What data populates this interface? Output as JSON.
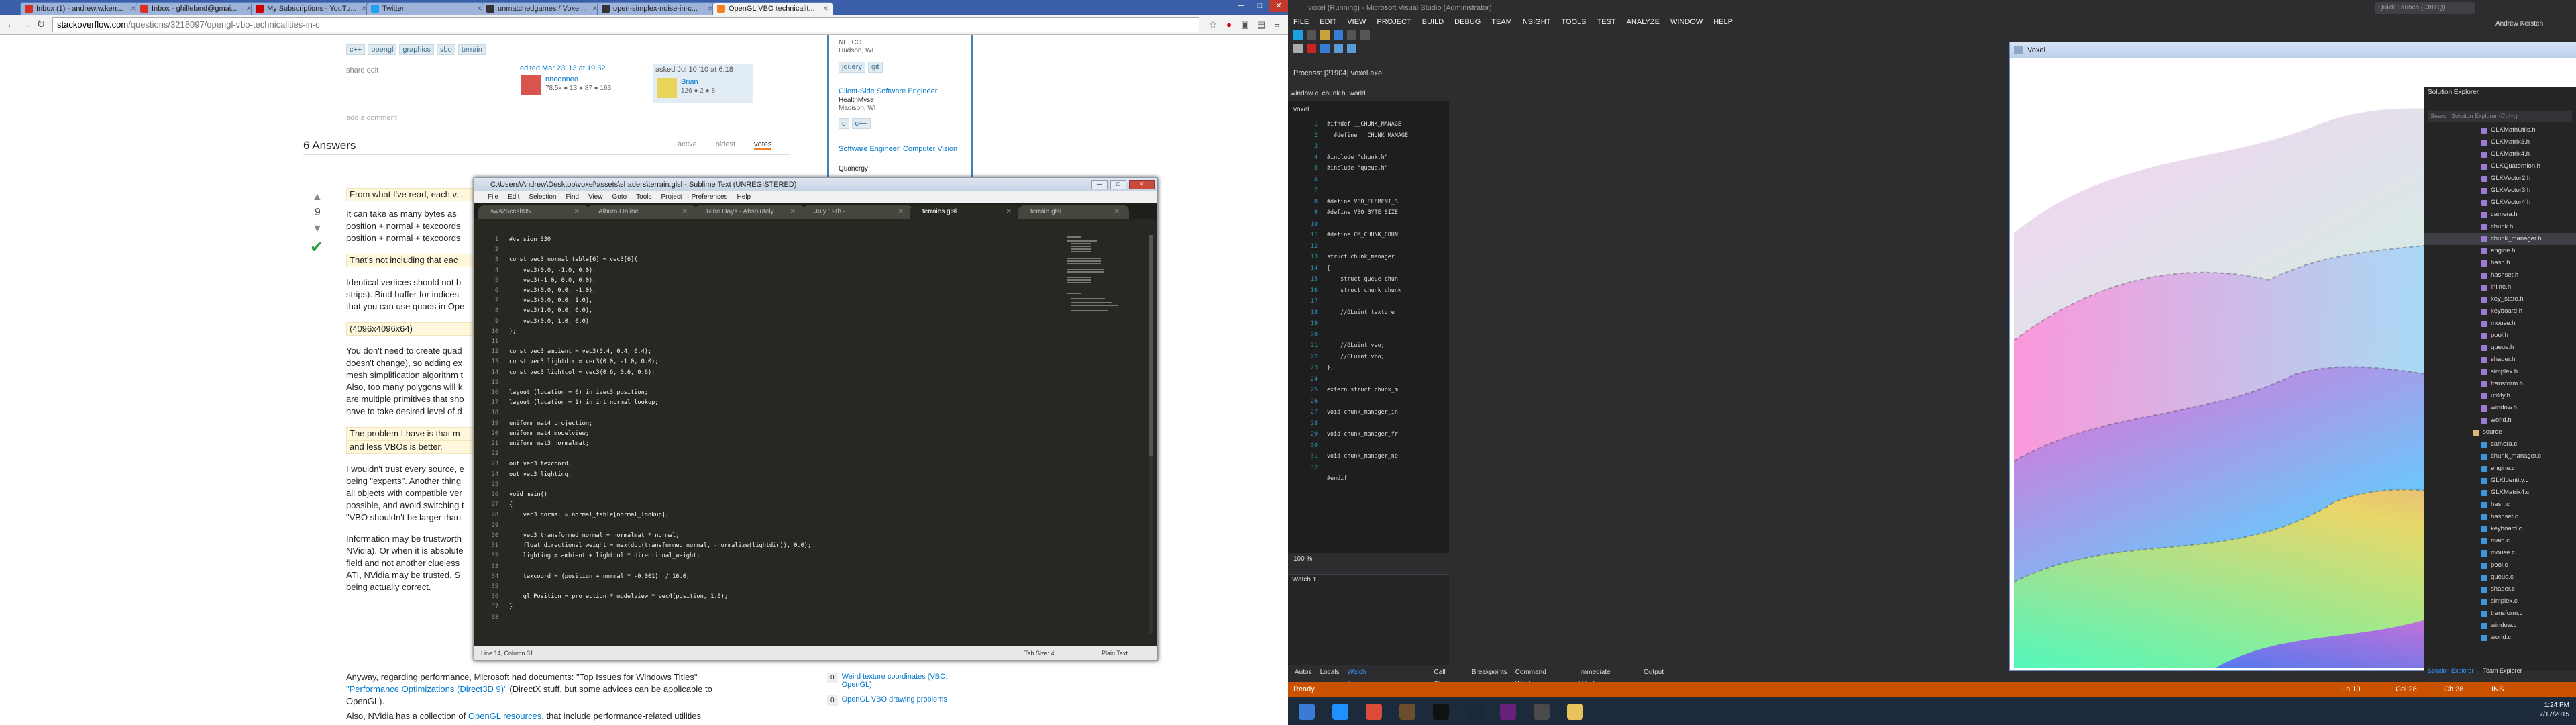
{
  "chrome": {
    "tabs": [
      {
        "label": "Inbox (1) - andrew.w.kerr...",
        "color": "#d93025"
      },
      {
        "label": "Inbox - ghilleland@gmai...",
        "color": "#d93025"
      },
      {
        "label": "My Subscriptions - YouTu...",
        "color": "#cc0000"
      },
      {
        "label": "Twitter",
        "color": "#1da1f2"
      },
      {
        "label": "unmatchedgames / Voxe...",
        "color": "#333333"
      },
      {
        "label": "open-simplex-noise-in-c...",
        "color": "#333333"
      },
      {
        "label": "OpenGL VBO technicalit...",
        "color": "#f48024"
      }
    ],
    "url_domain": "stackoverflow.com",
    "url_path": "/questions/3218097/opengl-vbo-technicalities-in-c"
  },
  "so": {
    "tags_top": [
      "c++",
      "opengl",
      "graphics",
      "vbo",
      "terrain"
    ],
    "share_edit": "share  edit",
    "edited": "edited Mar 23 '13 at 19:32",
    "editor": "nneonneo",
    "editor_rep": "78.5k  ● 13  ● 87  ● 163",
    "asked": "asked Jul 10 '10 at 6:18",
    "asker": "Brian",
    "asker_rep": "126  ● 2  ● 8",
    "add_comment": "add a comment",
    "answers_count": "6 Answers",
    "sort_tabs": [
      "active",
      "oldest",
      "votes"
    ],
    "vote_count": "9",
    "answer_lines": [
      "From what I've read, each v...",
      "It can take as many bytes as",
      "position + normal + texcoords",
      "position + normal + texcoords",
      "That's not including that eac",
      "Identical vertices should not b",
      "strips). Bind buffer for indices",
      "that you can use quads in Ope",
      "(4096x4096x64)",
      "You don't need to create quad",
      "doesn't change), so adding ex",
      "mesh simplification algorithm t",
      "Also, too many polygons will k",
      "are multiple primitives that sho",
      "have to take desired level of d",
      "The problem I have is that m",
      "and less VBOs is better.",
      "I wouldn't trust every source, e",
      "being \"experts\". Another thing",
      "all objects with compatible ver",
      "possible, and avoid switching t",
      "\"VBO shouldn't be larger than",
      "Information may be trustworth",
      "NVidia). Or when it is absolute",
      "field and not another clueless",
      "ATI, NVidia may be trusted. S",
      "being actually correct."
    ],
    "anyway_text": "Anyway, regarding performance, Microsoft had documents: \"Top Issues for Windows Titles\"",
    "perf_link": "\"Performance Optimizations (Direct3D 9)\"",
    "perf_rest": " (DirectX stuff, but some advices can be applicable to",
    "perf_end": "OpenGL).",
    "nvidia_text": "Also, NVidia has a collection of ",
    "nvidia_link": "OpenGL resources",
    "nvidia_rest": ", that include performance-related utilities",
    "side_jobs": [
      {
        "loc": "NE, CO",
        "title": "",
        "company": ""
      },
      {
        "loc": "Hudson, WI",
        "title": "",
        "company": ""
      },
      {
        "loc": "Madison, WI",
        "title": "Client-Side Software Engineer",
        "company": "HealthMyse"
      },
      {
        "loc": "",
        "title": "Software Engineer, Computer Vision",
        "company": "Quanergy"
      }
    ],
    "side_tags1": [
      "jquery",
      "git"
    ],
    "side_tags2": [
      "c",
      "c++"
    ],
    "related": [
      {
        "count": "0",
        "title": "Weird texture coordinates (VBO, OpenGL)"
      },
      {
        "count": "0",
        "title": "OpenGL VBO drawing problems"
      }
    ]
  },
  "sublime": {
    "title": "C:\\Users\\Andrew\\Desktop\\voxel\\assets\\shaders\\terrain.glsl - Sublime Text (UNREGISTERED)",
    "menu": [
      "File",
      "Edit",
      "Selection",
      "Find",
      "View",
      "Goto",
      "Tools",
      "Project",
      "Preferences",
      "Help"
    ],
    "tabs": [
      "sws26ccsb05",
      "Album Online",
      "Nine Days - Absolutely",
      "July 19th -",
      "terrains.glsl",
      "terrain.glsl"
    ],
    "line_numbers": "1\n2\n3\n4\n5\n6\n7\n8\n9\n10\n11\n12\n13\n14\n15\n16\n17\n18\n19\n20\n21\n22\n23\n24\n25\n26\n27\n28\n29\n30\n31\n32\n33\n34\n35\n36\n37\n38",
    "code": "#version 330\n\nconst vec3 normal_table[6] = vec3[6](\n    vec3(0.0, -1.0, 0.0),\n    vec3(-1.0, 0.0, 0.0),\n    vec3(0.0, 0.0, -1.0),\n    vec3(0.0, 0.0, 1.0),\n    vec3(1.0, 0.0, 0.0),\n    vec3(0.0, 1.0, 0.0)\n);\n\nconst vec3 ambient = vec3(0.4, 0.4, 0.4);\nconst vec3 lightdir = vec3(0.0, -1.0, 0.0);\nconst vec3 lightcol = vec3(0.6, 0.6, 0.6);\n\nlayout (location = 0) in ivec3 position;\nlayout (location = 1) in int normal_lookup;\n\nuniform mat4 projection;\nuniform mat4 modelview;\nuniform mat3 normalmat;\n\nout vec3 texcoord;\nout vec3 lighting;\n\nvoid main()\n{\n    vec3 normal = normal_table[normal_lookup];\n\n    vec3 transformed_normal = normalmat * normal;\n    float directional_weight = max(dot(transformed_normal, -normalize(lightdir)), 0.0);\n    lighting = ambient + lightcol * directional_weight;\n\n    texcoord = (position + normal * -0.001)  / 16.0;\n\n    gl_Position = projection * modelview * vec4(position, 1.0);\n}\n",
    "status_left": "Line 14, Column 31",
    "status_tab": "Tab Size: 4",
    "status_syntax": "Plain Text"
  },
  "vs": {
    "title": "voxel (Running) - Microsoft Visual Studio (Administrator)",
    "menu": [
      "FILE",
      "EDIT",
      "VIEW",
      "PROJECT",
      "BUILD",
      "DEBUG",
      "TEAM",
      "NSIGHT",
      "TOOLS",
      "TEST",
      "ANALYZE",
      "WINDOW",
      "HELP"
    ],
    "quick_launch": "Quick Launch (Ctrl+Q)",
    "user": "Andrew Kersten",
    "process": "Process:  [21904] voxel.exe",
    "doc_tabs": [
      "window.c",
      "chunk.h",
      "world."
    ],
    "scope": "voxel",
    "code_lines": "#ifndef __CHUNK_MANAGE\n  #define __CHUNK_MANAGE\n\n#include \"chunk.h\"\n#include \"queue.h\"\n\n\n#define VBO_ELEMENT_S\n#define VBO_BYTE_SIZE\n\n#define CM_CHUNK_COUN\n\nstruct chunk_manager\n{\n    struct queue chun\n    struct chunk chunk\n\n    //GLuint texture\n\n\n    //GLuint vao;\n    //GLuint vbo;\n};\n\nextern struct chunk_m\n\nvoid chunk_manager_in\n\nvoid chunk_manager_fr\n\nvoid chunk_manager_ne\n\n#endif\n",
    "line_nums": "1\n2\n3\n4\n5\n6\n7\n8\n9\n10\n11\n12\n13\n14\n15\n16\n17\n18\n19\n20\n21\n22\n23\n24\n25\n26\n27\n28\n29\n30\n31\n32",
    "zoom": "100 %",
    "watch_title": "Watch 1",
    "bottom_tabs_left": [
      "Autos",
      "Locals",
      "Watch 1"
    ],
    "bottom_tabs_right": [
      "Call Stack",
      "Breakpoints",
      "Command Window",
      "Immediate Window",
      "Output"
    ],
    "status": "Ready",
    "status_ln": "Ln 10",
    "status_col": "Col 28",
    "status_ch": "Ch 28",
    "status_ins": "INS",
    "solution_explorer": "Solution Explorer",
    "se_search": "Search Solution Explorer (Ctrl+;)",
    "se_files": [
      "GLKMathUtils.h",
      "GLKMatrix3.h",
      "GLKMatrix4.h",
      "GLKQuaternion.h",
      "GLKVector2.h",
      "GLKVector3.h",
      "GLKVector4.h",
      "camera.h",
      "chunk.h",
      "chunk_manager.h",
      "engine.h",
      "hash.h",
      "hashset.h",
      "inline.h",
      "key_state.h",
      "keyboard.h",
      "mouse.h",
      "pool.h",
      "queue.h",
      "shader.h",
      "simplex.h",
      "transform.h",
      "utility.h",
      "window.h",
      "world.h"
    ],
    "se_source_folder": "source",
    "se_source_files": [
      "camera.c",
      "chunk_manager.c",
      "engine.c",
      "GLKIdentity.c",
      "GLKMatrix4.c",
      "hash.c",
      "hashset.c",
      "keyboard.c",
      "main.c",
      "mouse.c",
      "pool.c",
      "queue.c",
      "shader.c",
      "simplex.c",
      "transform.c",
      "window.c",
      "world.c"
    ],
    "se_footer_tabs": [
      "Solution Explorer",
      "Team Explorer"
    ]
  },
  "voxel": {
    "title": "Voxel"
  },
  "taskbar": {
    "apps": [
      {
        "name": "start-button",
        "color": "#3a7bd5"
      },
      {
        "name": "ie-icon",
        "color": "#1e90ff"
      },
      {
        "name": "chrome-icon",
        "color": "#dd4b39"
      },
      {
        "name": "minecraft-icon",
        "color": "#6b4e2e"
      },
      {
        "name": "console-icon",
        "color": "#111111"
      },
      {
        "name": "steam-icon",
        "color": "#1b2838"
      },
      {
        "name": "visual-studio-icon",
        "color": "#68217a"
      },
      {
        "name": "sublime-icon",
        "color": "#4a4a4a"
      },
      {
        "name": "explorer-icon",
        "color": "#e8c25a"
      }
    ],
    "time": "1:24 PM",
    "date": "7/17/2015"
  }
}
